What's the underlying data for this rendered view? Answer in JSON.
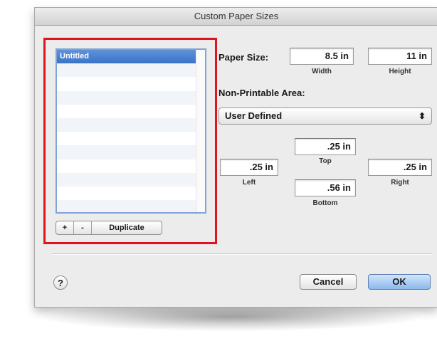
{
  "dialog": {
    "title": "Custom Paper Sizes"
  },
  "list": {
    "items": [
      "Untitled"
    ],
    "selected_index": 0,
    "visible_rows": 12
  },
  "list_buttons": {
    "add": "+",
    "remove": "-",
    "duplicate": "Duplicate"
  },
  "paper_size": {
    "label": "Paper Size:",
    "width_value": "8.5  in",
    "width_label": "Width",
    "height_value": "11  in",
    "height_label": "Height"
  },
  "non_printable": {
    "label": "Non-Printable Area:",
    "selected": "User Defined",
    "arrows": "⬍",
    "top_value": ".25  in",
    "top_label": "Top",
    "left_value": ".25  in",
    "left_label": "Left",
    "right_value": ".25  in",
    "right_label": "Right",
    "bottom_value": ".56  in",
    "bottom_label": "Bottom"
  },
  "footer": {
    "help": "?",
    "cancel": "Cancel",
    "ok": "OK"
  },
  "colors": {
    "highlight_border": "#e0141b",
    "selection": "#3a74c7",
    "default_button": "#8bb8ec"
  }
}
